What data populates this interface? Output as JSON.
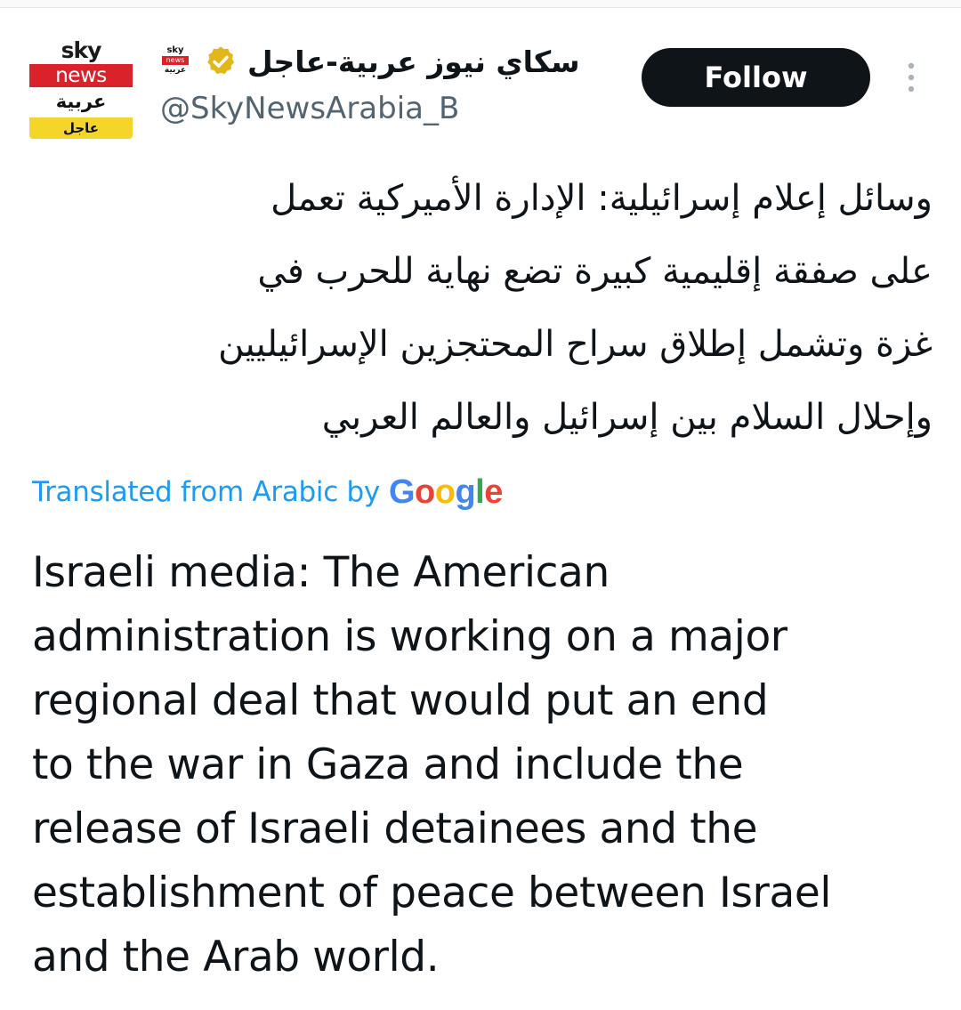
{
  "account": {
    "display_name": "سكاي نيوز عربية-عاجل",
    "handle": "@SkyNewsArabia_B",
    "verified": true,
    "avatar": {
      "line1": "sky",
      "line2": "news",
      "line3": "عربية",
      "line4": "عاجل"
    },
    "mini_logo": {
      "line1": "sky",
      "line2": "news",
      "line3": "عربية"
    }
  },
  "actions": {
    "follow_label": "Follow",
    "more_icon": "more-vertical-icon"
  },
  "tweet": {
    "original_lines": [
      "وسائل إعلام إسرائيلية: الإدارة الأميركية تعمل",
      "على صفقة إقليمية كبيرة تضع نهاية للحرب في",
      "غزة وتشمل إطلاق سراح المحتجزين الإسرائيليين",
      "وإحلال السلام بين إسرائيل والعالم العربي"
    ],
    "translation_label": "Translated from Arabic by",
    "translation_provider": "Google",
    "translated_lines": [
      "Israeli media: The American",
      "administration is working on a major",
      "regional deal that would put an end",
      "to the war in Gaza and include the",
      "release of Israeli detainees and the",
      "establishment of peace between Israel",
      "and the Arab world."
    ]
  },
  "colors": {
    "text_primary": "#0f1419",
    "text_secondary": "#536471",
    "link_blue": "#1d9bf0",
    "follow_bg": "#0f1419",
    "verified_gold": "#e2b719",
    "brand_red": "#d9222a",
    "brand_yellow": "#f5d52a",
    "google_blue": "#4285f4",
    "google_red": "#ea4335",
    "google_yellow": "#fbbc05",
    "google_green": "#34a853"
  }
}
